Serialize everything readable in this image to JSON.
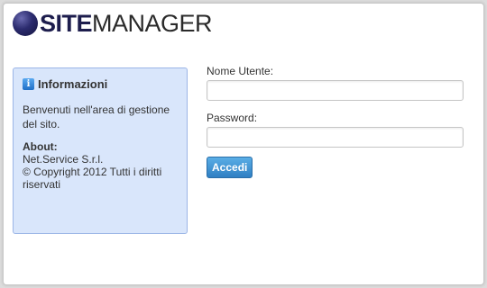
{
  "logo": {
    "part1": "SITE",
    "part2": "MANAGER"
  },
  "info": {
    "title": "Informazioni",
    "text": "Benvenuti nell'area di gestione del sito.",
    "about_title": "About:",
    "about_lines": [
      "Net.Service S.r.l.",
      "© Copyright 2012 Tutti i diritti riservati"
    ]
  },
  "form": {
    "username_label": "Nome Utente:",
    "username_value": "",
    "password_label": "Password:",
    "password_value": "",
    "submit_label": "Accedi"
  },
  "colors": {
    "accent": "#2f7fc3",
    "info_bg": "#d9e6fb",
    "info_border": "#9bb5e6",
    "logo_dark": "#1d1d4d"
  }
}
